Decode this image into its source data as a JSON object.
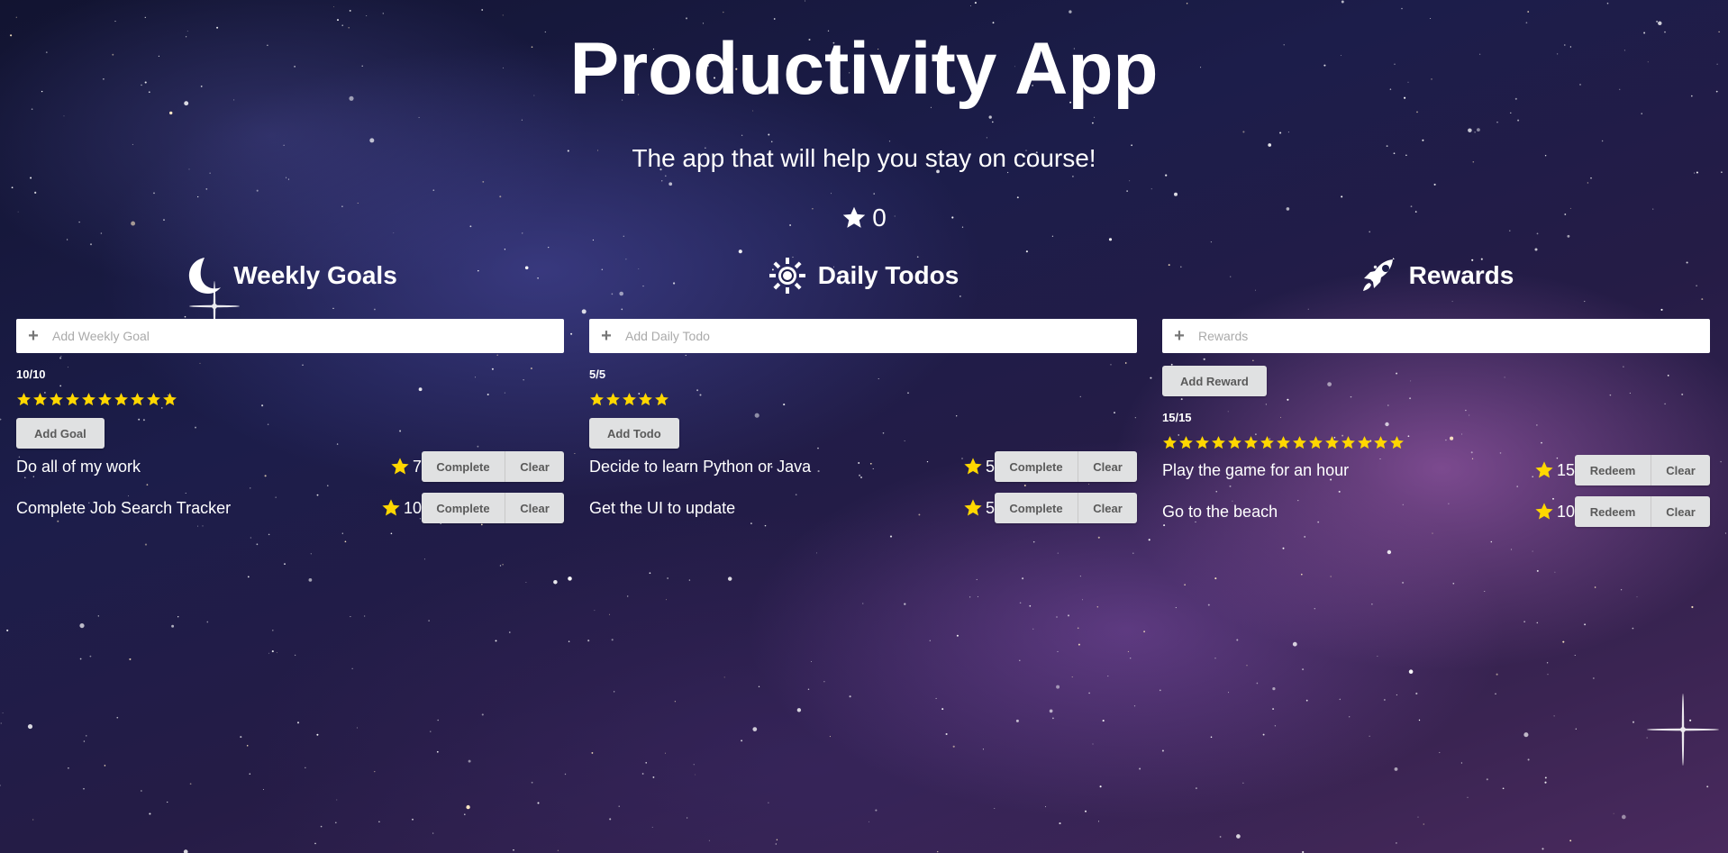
{
  "app": {
    "title": "Productivity App",
    "subtitle": "The app that will help you stay on course!",
    "points": "0"
  },
  "colors": {
    "star": "#ffd700",
    "button_bg": "#e0e1e2",
    "button_text": "#5a5a5a"
  },
  "columns": [
    {
      "id": "weekly",
      "icon": "moon-icon",
      "heading": "Weekly Goals",
      "placeholder": "Add Weekly Goal",
      "add_label": "Add Goal",
      "progress": "10/10",
      "progress_stars": 10,
      "items": [
        {
          "name": "Do all of my work",
          "points": "7",
          "primary": "Complete",
          "secondary": "Clear"
        },
        {
          "name": "Complete Job Search Tracker",
          "points": "10",
          "primary": "Complete",
          "secondary": "Clear"
        }
      ]
    },
    {
      "id": "daily",
      "icon": "sun-icon",
      "heading": "Daily Todos",
      "placeholder": "Add Daily Todo",
      "add_label": "Add Todo",
      "progress": "5/5",
      "progress_stars": 5,
      "items": [
        {
          "name": "Decide to learn Python or Java",
          "points": "5",
          "primary": "Complete",
          "secondary": "Clear"
        },
        {
          "name": "Get the UI to update",
          "points": "5",
          "primary": "Complete",
          "secondary": "Clear"
        }
      ]
    },
    {
      "id": "rewards",
      "icon": "rocket-icon",
      "heading": "Rewards",
      "placeholder": "Rewards",
      "add_label": "Add Reward",
      "progress": "15/15",
      "progress_stars": 15,
      "items": [
        {
          "name": "Play the game for an hour",
          "points": "15",
          "primary": "Redeem",
          "secondary": "Clear"
        },
        {
          "name": "Go to the beach",
          "points": "10",
          "primary": "Redeem",
          "secondary": "Clear"
        }
      ]
    }
  ]
}
